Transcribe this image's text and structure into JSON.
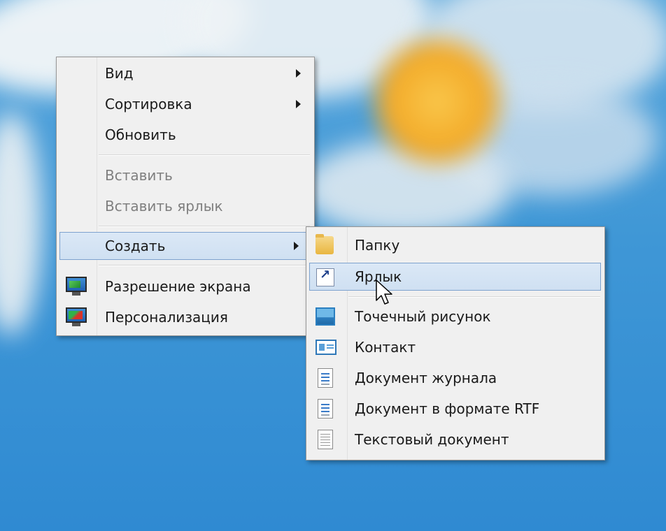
{
  "main_menu": {
    "items": [
      {
        "label": "Вид",
        "has_submenu": true,
        "disabled": false
      },
      {
        "label": "Сортировка",
        "has_submenu": true,
        "disabled": false
      },
      {
        "label": "Обновить",
        "has_submenu": false,
        "disabled": false
      },
      {
        "label": "Вставить",
        "has_submenu": false,
        "disabled": true
      },
      {
        "label": "Вставить ярлык",
        "has_submenu": false,
        "disabled": true
      },
      {
        "label": "Создать",
        "has_submenu": true,
        "disabled": false,
        "highlighted": true
      },
      {
        "label": "Разрешение экрана",
        "icon": "display-settings-icon",
        "disabled": false
      },
      {
        "label": "Персонализация",
        "icon": "personalize-icon",
        "disabled": false
      }
    ]
  },
  "sub_menu": {
    "items": [
      {
        "label": "Папку",
        "icon": "folder-icon"
      },
      {
        "label": "Ярлык",
        "icon": "shortcut-icon",
        "highlighted": true
      },
      {
        "label": "Точечный рисунок",
        "icon": "bitmap-image-icon"
      },
      {
        "label": "Контакт",
        "icon": "contact-card-icon"
      },
      {
        "label": "Документ журнала",
        "icon": "journal-document-icon"
      },
      {
        "label": "Документ в формате RTF",
        "icon": "rtf-document-icon"
      },
      {
        "label": "Текстовый документ",
        "icon": "text-document-icon"
      }
    ]
  },
  "colors": {
    "menu_bg": "#f0f0f0",
    "highlight_bg": "#d6e6f5",
    "highlight_border": "#7da2ce",
    "disabled_text": "#7f7f7f"
  }
}
